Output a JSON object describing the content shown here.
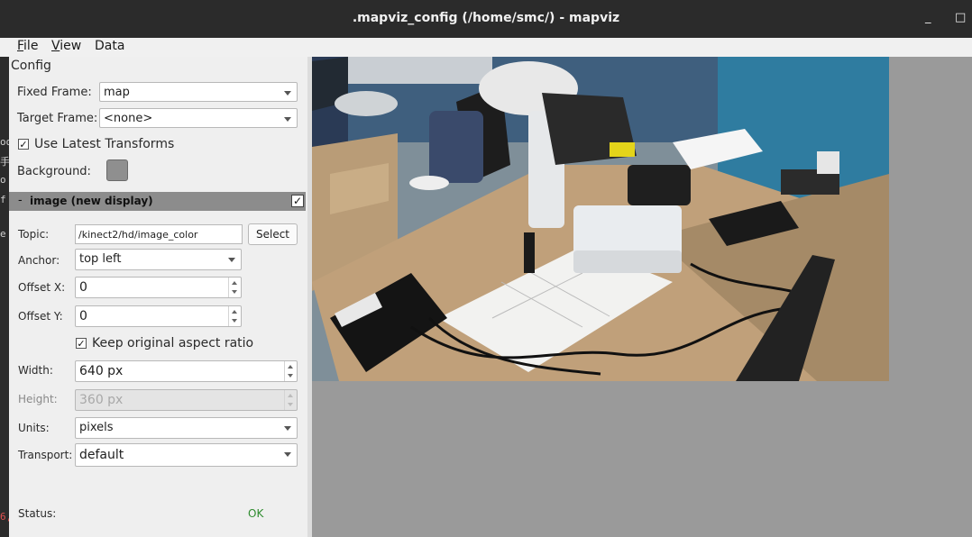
{
  "window": {
    "title": ".mapviz_config (/home/smc/) - mapviz",
    "minimize": "_",
    "maximize": "□"
  },
  "menu": {
    "file": {
      "accel": "F",
      "rest": "ile"
    },
    "view": {
      "accel": "V",
      "rest": "iew"
    },
    "data": "Data"
  },
  "left_edge_fragments": [
    "od",
    "手",
    "o",
    "f",
    "e",
    "6,"
  ],
  "config": {
    "heading": "Config",
    "fixed_frame": {
      "label": "Fixed Frame:",
      "value": "map"
    },
    "target_frame": {
      "label": "Target Frame:",
      "value": "<none>"
    },
    "use_latest_transforms": {
      "label": "Use Latest Transforms",
      "checked": true,
      "mark": "✓"
    },
    "background": {
      "label": "Background:",
      "color": "#8f8f8f"
    }
  },
  "display": {
    "collapse": "-",
    "name": "image (new display)",
    "visible_mark": "✓",
    "topic": {
      "label": "Topic:",
      "value": "/kinect2/hd/image_color",
      "button": "Select"
    },
    "anchor": {
      "label": "Anchor:",
      "value": "top left"
    },
    "offset_x": {
      "label": "Offset X:",
      "value": "0"
    },
    "offset_y": {
      "label": "Offset Y:",
      "value": "0"
    },
    "keep_aspect": {
      "label": "Keep original aspect ratio",
      "checked": true,
      "mark": "✓"
    },
    "width": {
      "label": "Width:",
      "value": "640 px"
    },
    "height": {
      "label": "Height:",
      "value": "360 px"
    },
    "units": {
      "label": "Units:",
      "value": "pixels"
    },
    "transport": {
      "label": "Transport:",
      "value": "default"
    },
    "status": {
      "label": "Status:",
      "value": "OK"
    }
  },
  "colors": {
    "titlebar": "#2b2b2b",
    "panel": "#efefef",
    "canvas": "#9a9a9a",
    "status_ok": "#2e8b2e",
    "display_header": "#8c8c8c"
  }
}
